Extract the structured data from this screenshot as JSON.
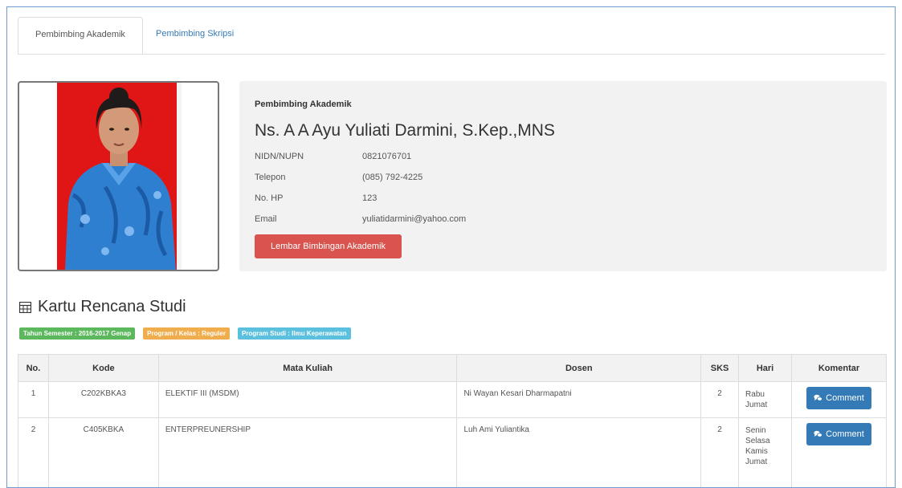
{
  "tabs": [
    {
      "label": "Pembimbing Akademik",
      "active": true
    },
    {
      "label": "Pembimbing Skripsi",
      "active": false
    }
  ],
  "advisor": {
    "role_label": "Pembimbing Akademik",
    "name": "Ns. A A Ayu Yuliati Darmini, S.Kep.,MNS",
    "fields": [
      {
        "label": "NIDN/NUPN",
        "value": "0821076701"
      },
      {
        "label": "Telepon",
        "value": "(085) 792-4225"
      },
      {
        "label": "No. HP",
        "value": "123"
      },
      {
        "label": "Email",
        "value": "yuliatidarmini@yahoo.com"
      }
    ],
    "button_label": "Lembar Bimbingan Akademik"
  },
  "krs": {
    "icon": "table-icon",
    "title": "Kartu Rencana Studi",
    "labels": [
      {
        "text": "Tahun Semester : 2016-2017 Genap",
        "color": "#5cb85c"
      },
      {
        "text": "Program / Kelas : Reguler",
        "color": "#f0ad4e"
      },
      {
        "text": "Program Studi : Ilmu Keperawatan",
        "color": "#5bc0de"
      }
    ]
  },
  "table": {
    "headers": [
      "No.",
      "Kode",
      "Mata Kuliah",
      "Dosen",
      "SKS",
      "Hari",
      "Komentar"
    ],
    "rows": [
      {
        "no": "1",
        "kode": "C202KBKA3",
        "mata_kuliah": "ELEKTIF III (MSDM)",
        "dosen": "Ni Wayan Kesari Dharmapatni",
        "sks": "2",
        "hari": [
          "Rabu",
          "Jumat"
        ],
        "komentar": "Comment"
      },
      {
        "no": "2",
        "kode": "C405KBKA",
        "mata_kuliah": "ENTERPREUNERSHIP",
        "dosen": "Luh Ami Yuliantika",
        "sks": "2",
        "hari": [
          "Senin",
          "Selasa",
          "Kamis",
          "Jumat"
        ],
        "komentar": "Comment"
      }
    ]
  },
  "colors": {
    "accent": "#337ab7",
    "danger": "#d9534f",
    "photo_bg": "#e01616"
  }
}
